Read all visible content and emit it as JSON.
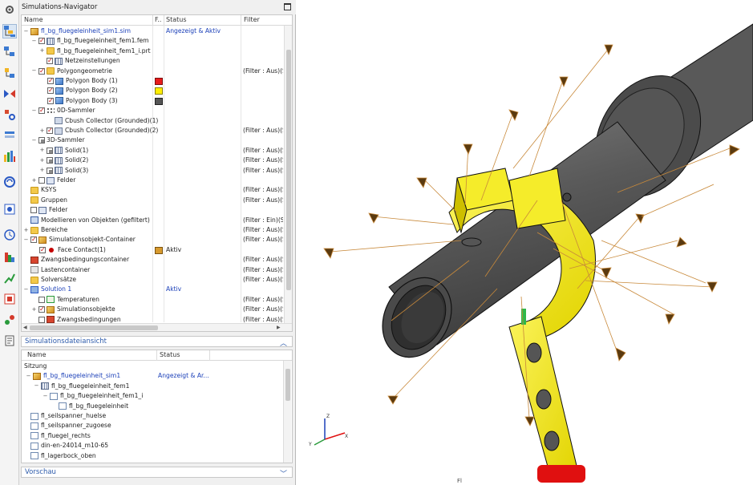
{
  "navigator": {
    "title": "Simulations-Navigator",
    "columns": {
      "name": "Name",
      "f": "F..",
      "status": "Status",
      "filter": "Filter"
    },
    "rows": [
      {
        "label": "fl_bg_fluegeleinheit_sim1.sim",
        "status": "Angezeigt & Aktiv",
        "filter": ""
      },
      {
        "label": "fl_bg_fluegeleinheit_fem1.fem",
        "status": "",
        "filter": ""
      },
      {
        "label": "fl_bg_fluegeleinheit_fem1_i.prt",
        "status": "",
        "filter": ""
      },
      {
        "label": "Netzeinstellungen",
        "status": "",
        "filter": ""
      },
      {
        "label": "Polygongeometrie",
        "status": "",
        "filter": "(Filter : Aus)(So"
      },
      {
        "label": "Polygon Body (1)",
        "status": "",
        "filter": ""
      },
      {
        "label": "Polygon Body (2)",
        "status": "",
        "filter": ""
      },
      {
        "label": "Polygon Body (3)",
        "status": "",
        "filter": ""
      },
      {
        "label": "0D-Sammler",
        "status": "",
        "filter": ""
      },
      {
        "label": "Cbush Collector (Grounded)(1)",
        "status": "",
        "filter": ""
      },
      {
        "label": "Cbush Collector (Grounded)(2)",
        "status": "",
        "filter": "(Filter : Aus)(So"
      },
      {
        "label": "3D-Sammler",
        "status": "",
        "filter": ""
      },
      {
        "label": "Solid(1)",
        "status": "",
        "filter": "(Filter : Aus)(So"
      },
      {
        "label": "Solid(2)",
        "status": "",
        "filter": "(Filter : Aus)(So"
      },
      {
        "label": "Solid(3)",
        "status": "",
        "filter": "(Filter : Aus)(So"
      },
      {
        "label": "Felder",
        "status": "",
        "filter": ""
      },
      {
        "label": "KSYS",
        "status": "",
        "filter": "(Filter : Aus)(So"
      },
      {
        "label": "Gruppen",
        "status": "",
        "filter": "(Filter : Aus)(So"
      },
      {
        "label": "Felder",
        "status": "",
        "filter": ""
      },
      {
        "label": "Modellieren von Objekten (gefiltert)",
        "status": "",
        "filter": "(Filter : Ein)(Sort"
      },
      {
        "label": "Bereiche",
        "status": "",
        "filter": "(Filter : Aus)(So"
      },
      {
        "label": "Simulationsobjekt-Container",
        "status": "",
        "filter": "(Filter : Aus)(So"
      },
      {
        "label": "Face Contact(1)",
        "status": "Aktiv",
        "filter": ""
      },
      {
        "label": "Zwangsbedingungscontainer",
        "status": "",
        "filter": "(Filter : Aus)(So"
      },
      {
        "label": "Lastencontainer",
        "status": "",
        "filter": "(Filter : Aus)(So"
      },
      {
        "label": "Solversätze",
        "status": "",
        "filter": "(Filter : Aus)(So"
      },
      {
        "label": "Solution 1",
        "status": "Aktiv",
        "filter": ""
      },
      {
        "label": "Temperaturen",
        "status": "",
        "filter": "(Filter : Aus)(So"
      },
      {
        "label": "Simulationsobjekte",
        "status": "",
        "filter": "(Filter : Aus)(So"
      },
      {
        "label": "Zwangsbedingungen",
        "status": "",
        "filter": "(Filter : Aus)(So"
      }
    ],
    "swatches": {
      "body1": "#e81b1b",
      "body2": "#ffee00",
      "body3": "#555555",
      "contact": "#d79a2e"
    }
  },
  "file_view": {
    "title": "Simulationsdateiansicht",
    "columns": {
      "name": "Name",
      "status": "Status"
    },
    "rows": [
      {
        "label": "Sitzung",
        "status": ""
      },
      {
        "label": "fl_bg_fluegeleinheit_sim1",
        "status": "Angezeigt & Ar..."
      },
      {
        "label": "fl_bg_fluegeleinheit_fem1",
        "status": ""
      },
      {
        "label": "fl_bg_fluegeleinheit_fem1_i",
        "status": ""
      },
      {
        "label": "fl_bg_fluegeleinheit",
        "status": ""
      },
      {
        "label": "fl_seilspanner_huelse",
        "status": ""
      },
      {
        "label": "fl_seilspanner_zugoese",
        "status": ""
      },
      {
        "label": "fl_fluegel_rechts",
        "status": ""
      },
      {
        "label": "din-en-24014_m10-65",
        "status": ""
      },
      {
        "label": "fl_lagerbock_oben",
        "status": ""
      }
    ]
  },
  "preview": {
    "title": "Vorschau"
  },
  "viewport": {
    "caption": "Fl"
  }
}
